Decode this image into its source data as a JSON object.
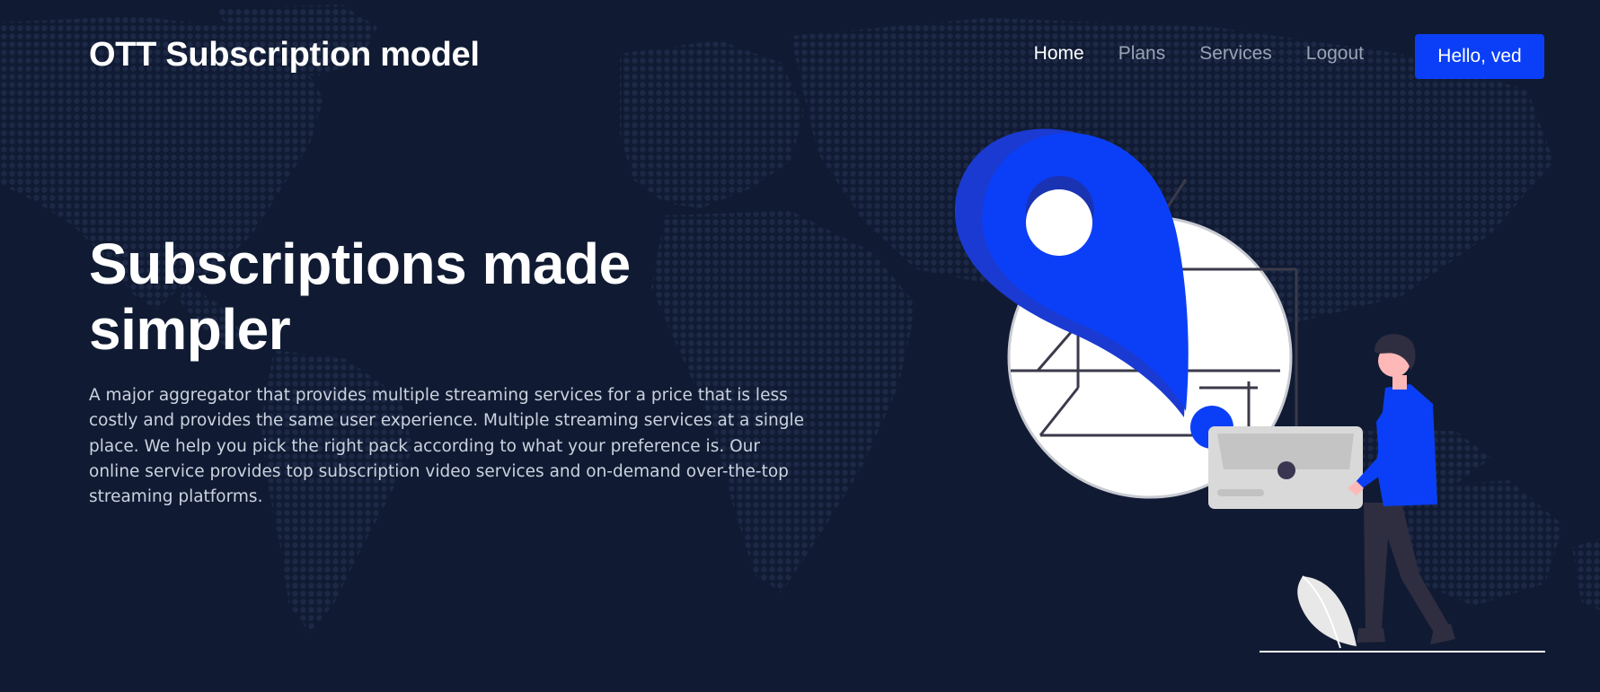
{
  "header": {
    "brand": "OTT Subscription model",
    "nav": [
      {
        "label": "Home",
        "active": true
      },
      {
        "label": "Plans",
        "active": false
      },
      {
        "label": "Services",
        "active": false
      },
      {
        "label": "Logout",
        "active": false
      }
    ],
    "user_button": "Hello, ved"
  },
  "hero": {
    "title": "Subscriptions made simpler",
    "description": "A major aggregator that provides multiple streaming services for a price that is less costly and provides the same user experience. Multiple streaming services at a single place. We help you pick the right pack according to what your preference is. Our online service provides top subscription video services and on-demand over-the-top streaming platforms."
  },
  "colors": {
    "background": "#101b33",
    "accent": "#0b3ff7",
    "dot": "#1c2845"
  },
  "icons": {
    "illustration": "location-pin-person-illustration"
  }
}
